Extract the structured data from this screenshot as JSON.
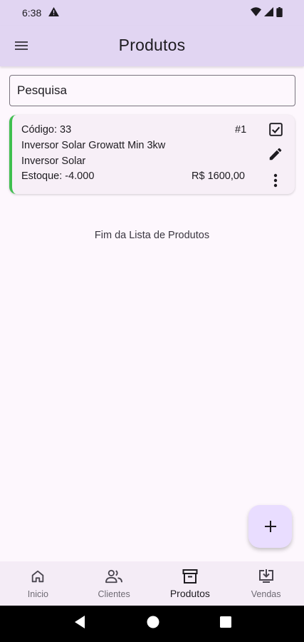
{
  "status_bar": {
    "time": "6:38"
  },
  "app_bar": {
    "title": "Produtos"
  },
  "search": {
    "placeholder": "Pesquisa"
  },
  "products": [
    {
      "code": "Código: 33",
      "index": "#1",
      "name": "Inversor Solar Growatt Min 3kw",
      "category": "Inversor Solar",
      "stock": "Estoque: -4.000",
      "price": "R$ 1600,00",
      "accent_color": "#3fbf4f"
    }
  ],
  "list_end": "Fim da Lista de Produtos",
  "bottom_nav": {
    "items": [
      {
        "label": "Inicio",
        "icon": "home-icon",
        "active": false
      },
      {
        "label": "Clientes",
        "icon": "people-icon",
        "active": false
      },
      {
        "label": "Produtos",
        "icon": "inventory-box-icon",
        "active": true
      },
      {
        "label": "Vendas",
        "icon": "download-screen-icon",
        "active": false
      }
    ]
  },
  "colors": {
    "app_bar": "#e1d5f2",
    "background": "#fdf7fd",
    "fab": "#e9ddff",
    "card_accent": "#3fbf4f"
  }
}
